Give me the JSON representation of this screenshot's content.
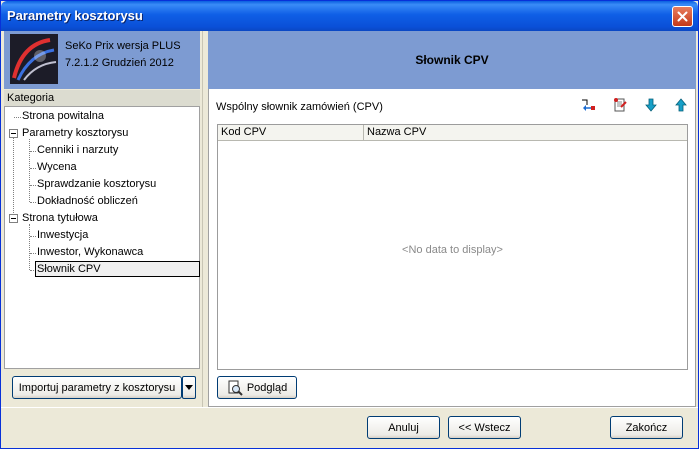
{
  "window": {
    "title": "Parametry kosztorysu"
  },
  "app": {
    "name": "SeKo Prix wersja PLUS",
    "version": "7.2.1.2 Grudzień 2012"
  },
  "sidebar": {
    "header": "Kategoria",
    "items": [
      {
        "label": "Strona powitalna"
      },
      {
        "label": "Parametry kosztorysu"
      },
      {
        "label": "Cenniki i narzuty"
      },
      {
        "label": "Wycena"
      },
      {
        "label": "Sprawdzanie kosztorysu"
      },
      {
        "label": "Dokładność obliczeń"
      },
      {
        "label": "Strona tytułowa"
      },
      {
        "label": "Inwestycja"
      },
      {
        "label": "Inwestor, Wykonawca"
      },
      {
        "label": "Słownik CPV"
      }
    ],
    "import_label": "Importuj parametry z kosztorysu"
  },
  "main": {
    "title": "Słownik CPV",
    "group_label": "Wspólny słownik zamówień (CPV)",
    "columns": [
      "Kod CPV",
      "Nazwa CPV"
    ],
    "empty_text": "<No data to display>",
    "preview_label": "Podgląd"
  },
  "footer": {
    "cancel_label": "Anuluj",
    "back_label": "<< Wstecz",
    "finish_label": "Zakończ"
  },
  "icons": {
    "close": "close-icon",
    "dropdown": "chevron-down-icon",
    "move_down": "arrow-down-icon",
    "move_up": "arrow-up-icon"
  },
  "colors": {
    "titlebar": "#0a5fe0",
    "panel_header": "#7d9bd2",
    "window_bg": "#ece9d8"
  }
}
